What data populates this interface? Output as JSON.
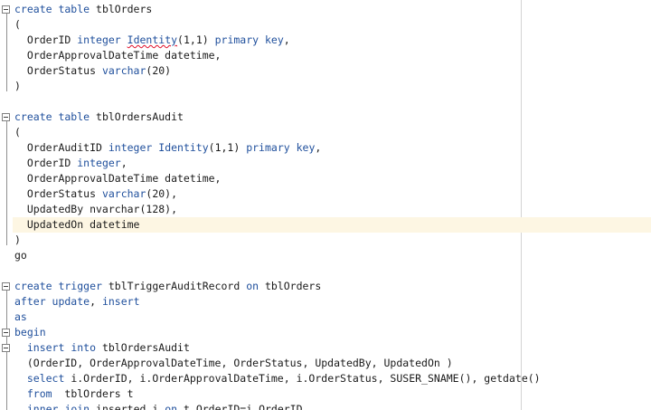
{
  "colors": {
    "keyword": "#1f4f9c",
    "plain": "#1a1a1a",
    "current_line": "#fdf6e3",
    "margin_line": "#d4d4d4",
    "spell_error": "#e0102a"
  },
  "fold_markers": [
    {
      "name": "fold-create-table-tblorders",
      "state": "expanded"
    },
    {
      "name": "fold-create-table-tblordersaudit",
      "state": "expanded"
    },
    {
      "name": "fold-create-trigger",
      "state": "expanded"
    },
    {
      "name": "fold-begin-block",
      "state": "expanded"
    },
    {
      "name": "fold-insert-statement",
      "state": "expanded"
    }
  ],
  "code": {
    "l1": {
      "k1": "create table",
      "t1": " tblOrders"
    },
    "l2": {
      "t1": "("
    },
    "l3": {
      "t1": "  OrderID ",
      "k1": "integer",
      "t2": " ",
      "f1": "Identity",
      "t3": "(1,1) ",
      "k2": "primary key",
      "t4": ","
    },
    "l4": {
      "t1": "  OrderApprovalDateTime datetime,"
    },
    "l5": {
      "t1": "  OrderStatus ",
      "k1": "varchar",
      "t2": "(20)"
    },
    "l6": {
      "t1": ")"
    },
    "l7": {
      "t1": ""
    },
    "l8": {
      "k1": "create table",
      "t1": " tblOrdersAudit"
    },
    "l9": {
      "t1": "("
    },
    "l10": {
      "t1": "  OrderAuditID ",
      "k1": "integer",
      "t2": " ",
      "f1": "Identity",
      "t3": "(1,1) ",
      "k2": "primary key",
      "t4": ","
    },
    "l11": {
      "t1": "  OrderID ",
      "k1": "integer",
      "t2": ","
    },
    "l12": {
      "t1": "  OrderApprovalDateTime datetime,"
    },
    "l13": {
      "t1": "  OrderStatus ",
      "k1": "varchar",
      "t2": "(20),"
    },
    "l14": {
      "t1": "  UpdatedBy nvarchar(128),"
    },
    "l15": {
      "t1": "  UpdatedOn datetime"
    },
    "l16": {
      "t1": ")"
    },
    "l17": {
      "t1": "go"
    },
    "l18": {
      "t1": ""
    },
    "l19": {
      "k1": "create trigger",
      "t1": " tblTriggerAuditRecord ",
      "k2": "on",
      "t2": " tblOrders"
    },
    "l20": {
      "k1": "after update",
      "t1": ", ",
      "k2": "insert"
    },
    "l21": {
      "k1": "as"
    },
    "l22": {
      "k1": "begin"
    },
    "l23": {
      "t1": "  ",
      "k1": "insert into",
      "t2": " tblOrdersAudit"
    },
    "l24": {
      "t1": "  (OrderID, OrderApprovalDateTime, OrderStatus, UpdatedBy, UpdatedOn )"
    },
    "l25": {
      "t1": "  ",
      "k1": "select",
      "t2": " i.OrderID, i.OrderApprovalDateTime, i.OrderStatus, SUSER_SNAME(), getdate()"
    },
    "l26": {
      "t1": "  ",
      "k1": "from",
      "t2": "  tblOrders t"
    },
    "l27": {
      "t1": "  ",
      "k1": "inner join",
      "t2": " inserted i ",
      "k2": "on",
      "t3": " t.OrderID=i.OrderID"
    }
  }
}
